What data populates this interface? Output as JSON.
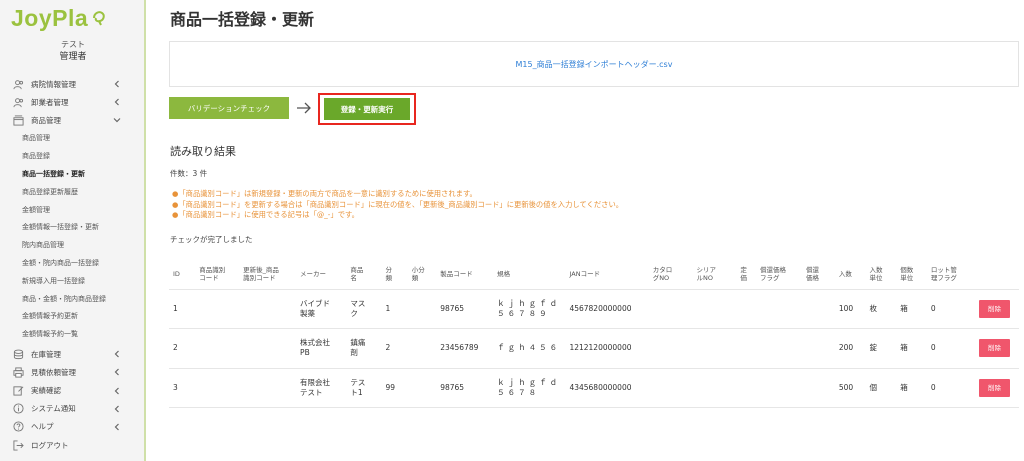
{
  "app": {
    "logo_text": "JoyPla",
    "user_name": "テスト",
    "user_role": "管理者",
    "brand_color": "#9bc23f"
  },
  "sidebar": {
    "sections": [
      {
        "label": "病院情報管理",
        "icon": "users-icon"
      },
      {
        "label": "卸業者管理",
        "icon": "users-icon"
      },
      {
        "label": "商品管理",
        "icon": "box-icon",
        "expanded": true
      }
    ],
    "sub_items": [
      "商品管理",
      "商品登録",
      "商品一括登録・更新",
      "商品登録更新履歴",
      "金額管理",
      "金額情報一括登録・更新",
      "院内商品管理",
      "金額・院内商品一括登録",
      "新規導入用一括登録",
      "商品・金額・院内商品登録",
      "金額情報予約更新",
      "金額情報予約一覧"
    ],
    "active_sub_index": 2,
    "bottom_sections": [
      {
        "label": "在庫管理",
        "icon": "database-icon"
      },
      {
        "label": "見積依頼管理",
        "icon": "print-icon"
      },
      {
        "label": "実績確認",
        "icon": "edit-icon"
      },
      {
        "label": "システム通知",
        "icon": "info-icon"
      },
      {
        "label": "ヘルプ",
        "icon": "help-icon"
      },
      {
        "label": "ログアウト",
        "icon": "logout-icon"
      }
    ]
  },
  "main": {
    "title": "商品一括登録・更新",
    "file_name": "M15_商品一括登録インポートヘッダー.csv",
    "validate_button": "バリデーションチェック",
    "execute_button": "登録・更新実行",
    "result_title": "読み取り結果",
    "count_text": "件数：3 件",
    "notes": [
      "●「商品識別コード」は新規登録・更新の両方で商品を一意に識別するために使用されます。",
      "●「商品識別コード」を更新する場合は「商品識別コード」に現在の値を、「更新後_商品識別コード」に更新後の値を入力してください。",
      "●「商品識別コード」に使用できる記号は「@_-」です。"
    ],
    "check_message": "チェックが完了しました"
  },
  "table": {
    "headers": [
      "ID",
      "商品識別\nコード",
      "更新後_商品\n識別コード",
      "メーカー",
      "商品\n名",
      "分\n類",
      "小分\n類",
      "製品コード",
      "規格",
      "JANコード",
      "カタロ\nグNO",
      "シリア\nルNO",
      "定\n価",
      "償還価格\nフラグ",
      "償還\n価格",
      "入数",
      "入数\n単位",
      "個数\n単位",
      "ロット管\n理フラグ",
      ""
    ],
    "rows": [
      {
        "id": "1",
        "code": "",
        "new_code": "",
        "maker": "バイブド\n製薬",
        "name": "マス\nク",
        "cat": "1",
        "subcat": "",
        "product_code": "98765",
        "spec": "ｋｊｈｇｆｄ\n５６７８９",
        "jan": "4567820000000",
        "catalog": "",
        "serial": "",
        "price": "",
        "reimb_flag": "",
        "reimb_price": "",
        "qty": "100",
        "qty_unit": "枚",
        "item_unit": "箱",
        "lot_flag": "0",
        "action": "削除"
      },
      {
        "id": "2",
        "code": "",
        "new_code": "",
        "maker": "株式会社\nPB",
        "name": "鎮痛\n剤",
        "cat": "2",
        "subcat": "",
        "product_code": "23456789",
        "spec": "ｆｇｈ４５６",
        "jan": "1212120000000",
        "catalog": "",
        "serial": "",
        "price": "",
        "reimb_flag": "",
        "reimb_price": "",
        "qty": "200",
        "qty_unit": "錠",
        "item_unit": "箱",
        "lot_flag": "0",
        "action": "削除"
      },
      {
        "id": "3",
        "code": "",
        "new_code": "",
        "maker": "有限会社\nテスト",
        "name": "テス\nト1",
        "cat": "99",
        "subcat": "",
        "product_code": "98765",
        "spec": "ｋｊｈｇｆｄ\n５６７８",
        "jan": "4345680000000",
        "catalog": "",
        "serial": "",
        "price": "",
        "reimb_flag": "",
        "reimb_price": "",
        "qty": "500",
        "qty_unit": "個",
        "item_unit": "箱",
        "lot_flag": "0",
        "action": "削除"
      }
    ]
  }
}
